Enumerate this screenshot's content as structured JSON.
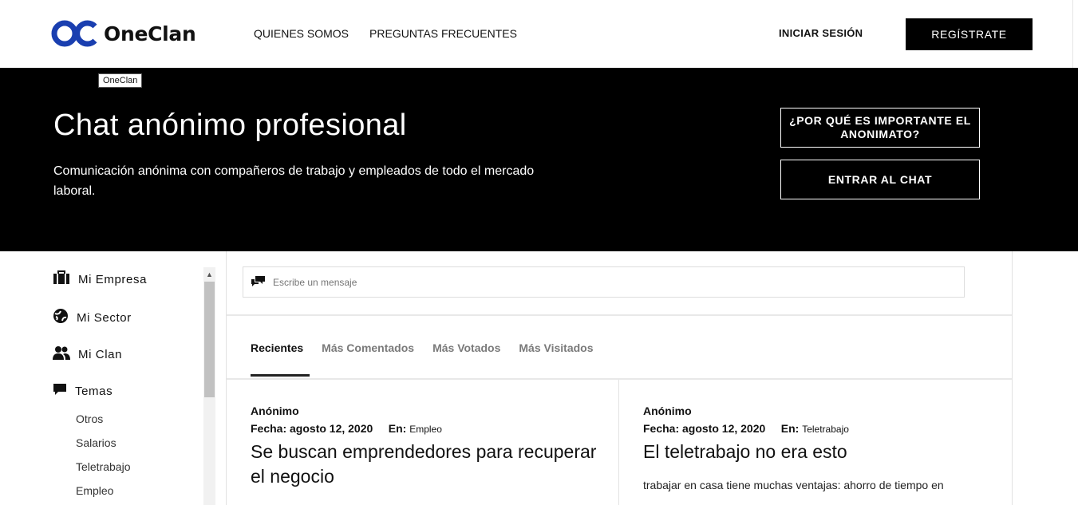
{
  "header": {
    "logo_text": "OneClan",
    "nav": [
      "QUIENES SOMOS",
      "PREGUNTAS FRECUENTES"
    ],
    "login_label": "INICIAR SESIÓN",
    "register_label": "REGÍSTRATE"
  },
  "hero": {
    "tooltip": "OneClan",
    "title": "Chat anónimo profesional",
    "subtitle": "Comunicación anónima con compañeros de trabajo y empleados de todo el mercado laboral.",
    "why_button": "¿POR QUÉ ES IMPORTANTE EL ANONIMATO?",
    "enter_button": "ENTRAR AL CHAT"
  },
  "sidebar": {
    "items": [
      {
        "label": "Mi Empresa",
        "icon": "briefcase-icon"
      },
      {
        "label": "Mi Sector",
        "icon": "globe-icon"
      },
      {
        "label": "Mi Clan",
        "icon": "users-icon"
      },
      {
        "label": "Temas",
        "icon": "chat-bubble-icon"
      }
    ],
    "subitems": [
      "Otros",
      "Salarios",
      "Teletrabajo",
      "Empleo"
    ]
  },
  "composer": {
    "placeholder": "Escribe un mensaje"
  },
  "tabs": [
    "Recientes",
    "Más Comentados",
    "Más Votados",
    "Más Visitados"
  ],
  "posts": [
    {
      "author": "Anónimo",
      "date_label": "Fecha:",
      "date": "agosto 12, 2020",
      "in_label": "En:",
      "category": "Empleo",
      "title": "Se buscan emprendedores para recuperar el negocio",
      "excerpt": ""
    },
    {
      "author": "Anónimo",
      "date_label": "Fecha:",
      "date": "agosto 12, 2020",
      "in_label": "En:",
      "category": "Teletrabajo",
      "title": "El teletrabajo no era esto",
      "excerpt": "trabajar en casa tiene muchas ventajas: ahorro de tiempo en"
    }
  ]
}
